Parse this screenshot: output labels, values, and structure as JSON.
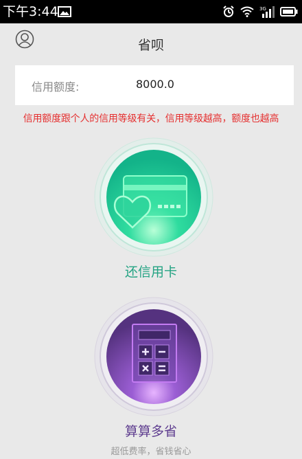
{
  "status_bar": {
    "time": "下午3:44",
    "icons": [
      "gallery-icon",
      "alarm-icon",
      "wifi-icon",
      "signal-icon",
      "battery-icon"
    ],
    "network_label": "3G"
  },
  "header": {
    "title": "省呗",
    "profile_icon": "user-profile-icon"
  },
  "credit": {
    "label": "信用额度:",
    "value": "8000.0"
  },
  "notice": "信用额度跟个人的信用等级有关，信用等级越高，额度也越高",
  "repay": {
    "label": "还信用卡",
    "icon": "credit-card-heart-icon",
    "color": "#24a383"
  },
  "calculator": {
    "label": "算算多省",
    "subtitle": "超低费率，省钱省心",
    "icon": "calculator-icon",
    "color": "#5e3d8f"
  },
  "colors": {
    "background": "#e9e9e9",
    "notice": "#e53030",
    "teal": "#24a383",
    "purple": "#5e3d8f"
  }
}
